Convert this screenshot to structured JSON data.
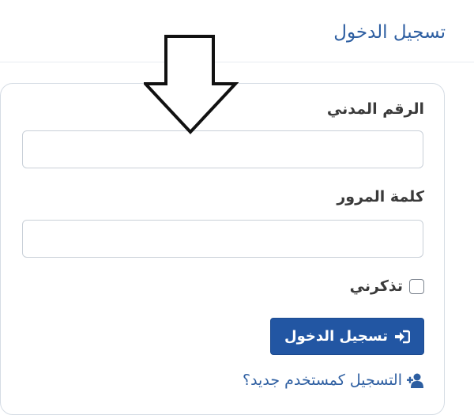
{
  "header": {
    "title": "تسجيل الدخول"
  },
  "form": {
    "civil_id": {
      "label": "الرقم المدني",
      "value": "",
      "placeholder": ""
    },
    "password": {
      "label": "كلمة المرور",
      "value": "",
      "placeholder": ""
    },
    "remember_me": {
      "label": "تذكرني",
      "checked": false
    },
    "login_button": {
      "label": "تسجيل الدخول",
      "icon": "sign-in-icon"
    },
    "register_link": {
      "label": "التسجيل كمستخدم جديد؟",
      "icon": "user-plus-icon"
    }
  },
  "annotation": {
    "icon": "down-arrow-icon"
  },
  "colors": {
    "accent": "#2256a3",
    "title_text": "#2d5ea1",
    "card_border": "#d5dce4"
  }
}
